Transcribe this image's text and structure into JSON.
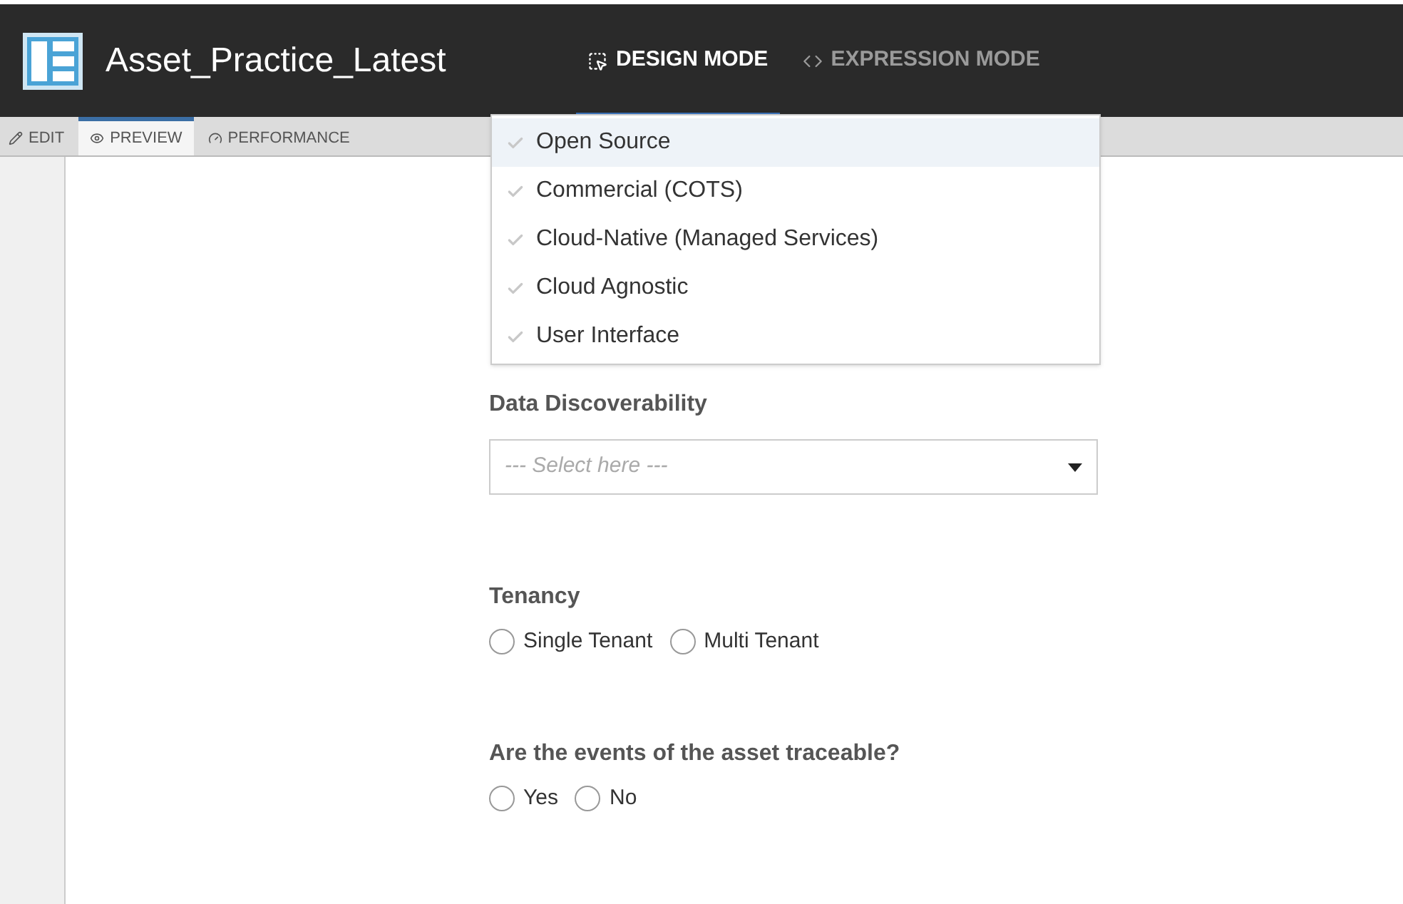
{
  "app": {
    "title": "Asset_Practice_Latest"
  },
  "modes": [
    {
      "label": "DESIGN MODE",
      "kind": "design",
      "selected": true
    },
    {
      "label": "EXPRESSION MODE",
      "kind": "expression",
      "selected": false
    }
  ],
  "tabs": [
    {
      "label": "EDIT",
      "kind": "edit",
      "selected": false
    },
    {
      "label": "PREVIEW",
      "kind": "preview",
      "selected": true
    },
    {
      "label": "PERFORMANCE",
      "kind": "performance",
      "selected": false
    }
  ],
  "dropdown_menu": {
    "options": [
      {
        "label": "Open Source",
        "checked": false,
        "selected": true
      },
      {
        "label": "Commercial (COTS)",
        "checked": false,
        "selected": false
      },
      {
        "label": "Cloud-Native (Managed Services)",
        "checked": false,
        "selected": false
      },
      {
        "label": "Cloud Agnostic",
        "checked": false,
        "selected": false
      },
      {
        "label": "User Interface",
        "checked": false,
        "selected": false
      }
    ]
  },
  "form": {
    "data_discoverability": {
      "label": "Data Discoverability",
      "placeholder": "--- Select here ---"
    },
    "tenancy": {
      "label": "Tenancy",
      "options": [
        {
          "label": "Single Tenant",
          "selected": false
        },
        {
          "label": "Multi Tenant",
          "selected": false
        }
      ]
    },
    "traceable": {
      "label": "Are the events of the asset traceable?",
      "options": [
        {
          "label": "Yes",
          "selected": false
        },
        {
          "label": "No",
          "selected": false
        }
      ]
    }
  }
}
